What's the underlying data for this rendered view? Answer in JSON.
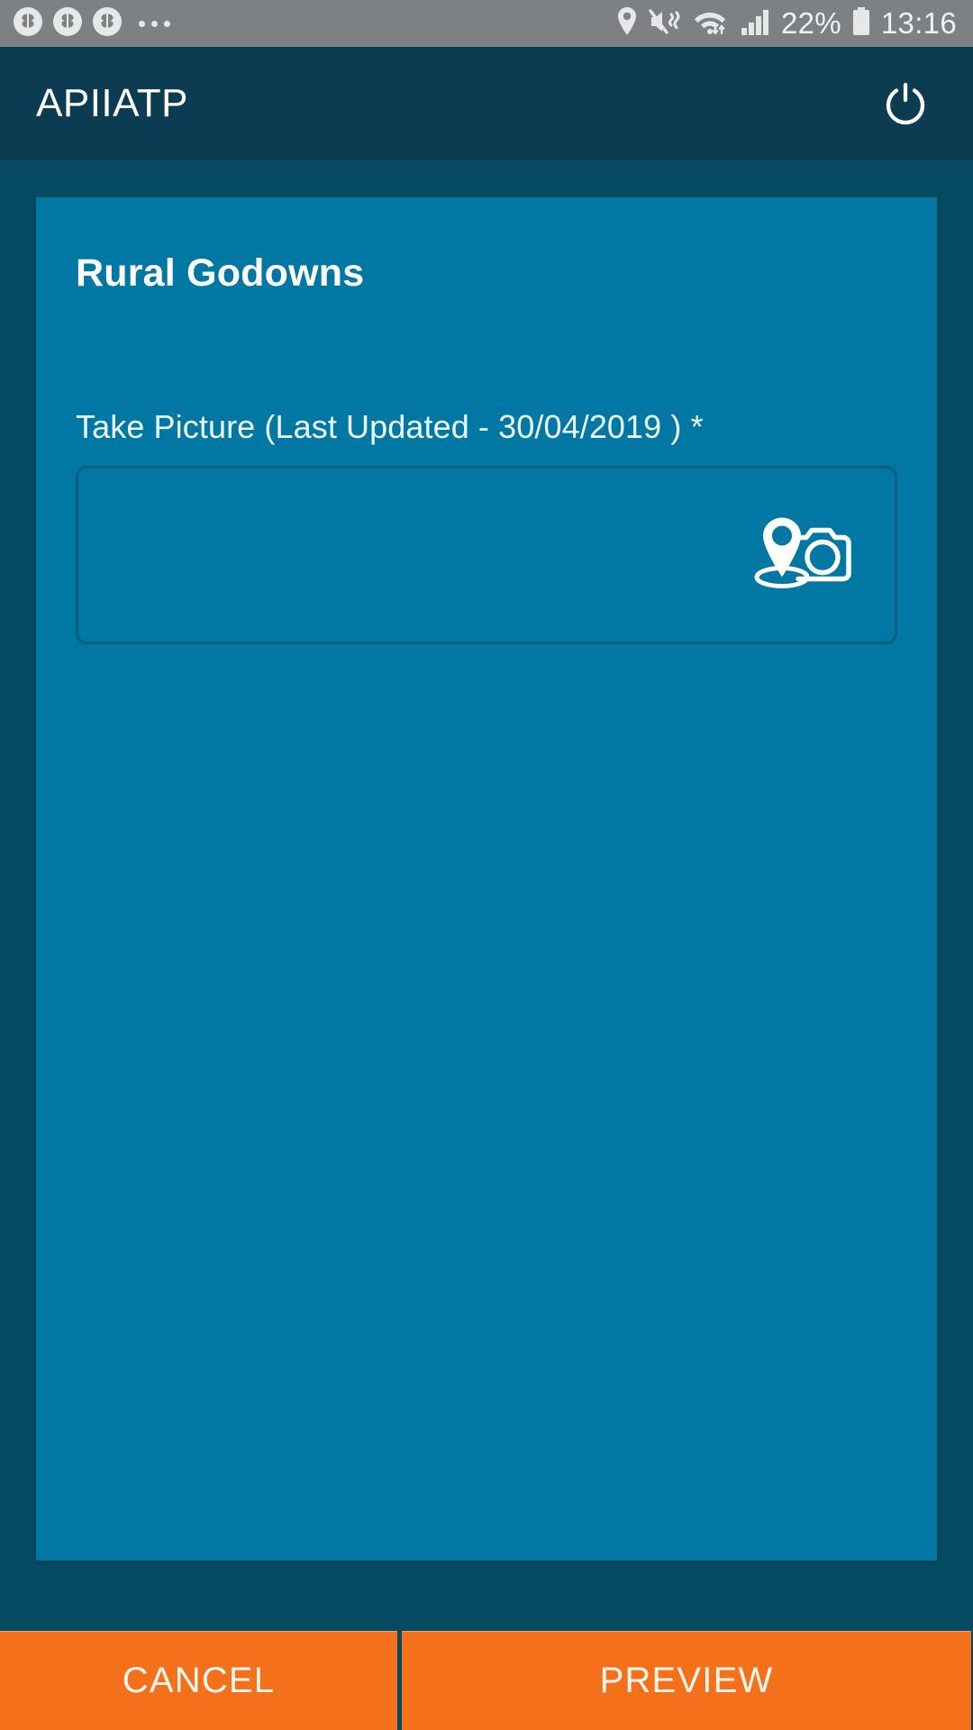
{
  "status_bar": {
    "notification_icons": [
      "app-clover-icon",
      "app-clover-icon",
      "app-clover-icon"
    ],
    "overflow": "more-notifications-icon",
    "right_icons": [
      "location-icon",
      "mute-vibrate-icon",
      "wifi-icon",
      "signal-bars-icon",
      "battery-icon"
    ],
    "battery_percent": "22%",
    "time": "13:16"
  },
  "app_bar": {
    "title": "APIIATP",
    "power_icon": "power-icon"
  },
  "card": {
    "title": "Rural Godowns",
    "field": {
      "label": "Take Picture (Last Updated - 30/04/2019 ) *",
      "capture_icon": "geo-camera-icon"
    }
  },
  "actions": {
    "cancel_label": "CANCEL",
    "preview_label": "PREVIEW"
  },
  "colors": {
    "status_bar": "#7d8183",
    "app_bar": "#0b3c51",
    "page_background": "#054A60",
    "card": "#0078a3",
    "accent_button": "#f4701b",
    "text_light": "#ffffff"
  }
}
